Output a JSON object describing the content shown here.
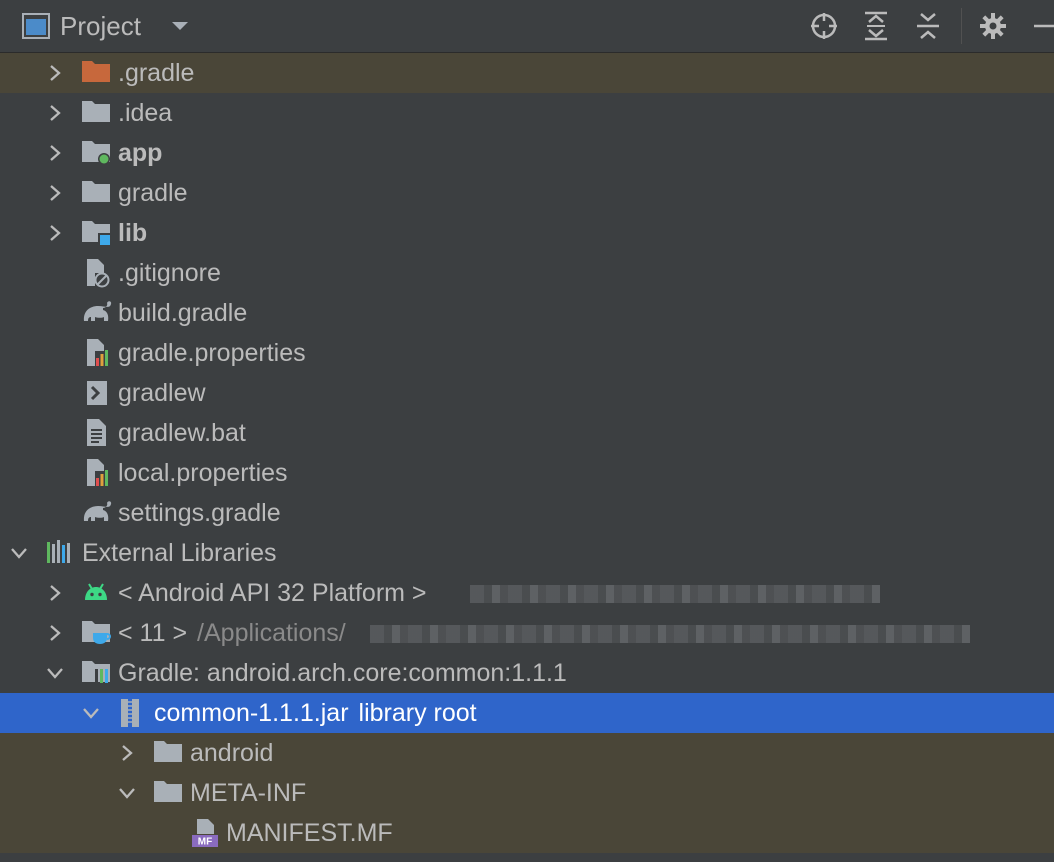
{
  "panel": {
    "title": "Project",
    "toolbar": [
      "locate-icon",
      "expand-all-icon",
      "collapse-all-icon",
      "gear-icon",
      "minimize-icon"
    ]
  },
  "tree": [
    {
      "label": ".gradle",
      "icon": "folder-orange",
      "arrow": "right",
      "depth": 1,
      "highlight": true
    },
    {
      "label": ".idea",
      "icon": "folder",
      "arrow": "right",
      "depth": 1
    },
    {
      "label": "app",
      "icon": "module-folder-green",
      "arrow": "right",
      "depth": 1,
      "bold": true
    },
    {
      "label": "gradle",
      "icon": "folder",
      "arrow": "right",
      "depth": 1
    },
    {
      "label": "lib",
      "icon": "module-folder-blue",
      "arrow": "right",
      "depth": 1,
      "bold": true
    },
    {
      "label": ".gitignore",
      "icon": "ignore-file",
      "depth": 1
    },
    {
      "label": "build.gradle",
      "icon": "gradle-elephant",
      "depth": 1
    },
    {
      "label": "gradle.properties",
      "icon": "properties-file",
      "depth": 1
    },
    {
      "label": "gradlew",
      "icon": "shell-script",
      "depth": 1
    },
    {
      "label": "gradlew.bat",
      "icon": "text-file",
      "depth": 1
    },
    {
      "label": "local.properties",
      "icon": "properties-file",
      "depth": 1
    },
    {
      "label": "settings.gradle",
      "icon": "gradle-elephant",
      "depth": 1
    },
    {
      "label": "External Libraries",
      "icon": "libraries",
      "arrow": "down",
      "depth": 0
    },
    {
      "label": "< Android API 32 Platform >",
      "icon": "android",
      "arrow": "right",
      "depth": 1,
      "blurred": true
    },
    {
      "label": "< 11 >",
      "path": "/Applications/",
      "icon": "jdk-folder",
      "arrow": "right",
      "depth": 1,
      "blurred": true
    },
    {
      "label": "Gradle: android.arch.core:common:1.1.1",
      "icon": "library",
      "arrow": "down",
      "depth": 1
    },
    {
      "label": "common-1.1.1.jar",
      "suffix": "library root",
      "icon": "jar",
      "arrow": "down",
      "depth": 2,
      "selected": true
    },
    {
      "label": "android",
      "icon": "folder",
      "arrow": "right",
      "depth": 3,
      "highlight": true
    },
    {
      "label": "META-INF",
      "icon": "folder",
      "arrow": "down",
      "depth": 3,
      "highlight": true
    },
    {
      "label": "MANIFEST.MF",
      "icon": "manifest-file",
      "depth": 4,
      "highlight": true
    }
  ],
  "colors": {
    "background": "#3c3f41",
    "highlight": "#4a4638",
    "selection": "#2f65ca",
    "text": "#bbbbbb",
    "folder": "#a9b0b7",
    "orange_folder": "#c7683c",
    "green_dot": "#5fb85f",
    "blue_square": "#3ea9ea",
    "android_green": "#3dd885"
  }
}
